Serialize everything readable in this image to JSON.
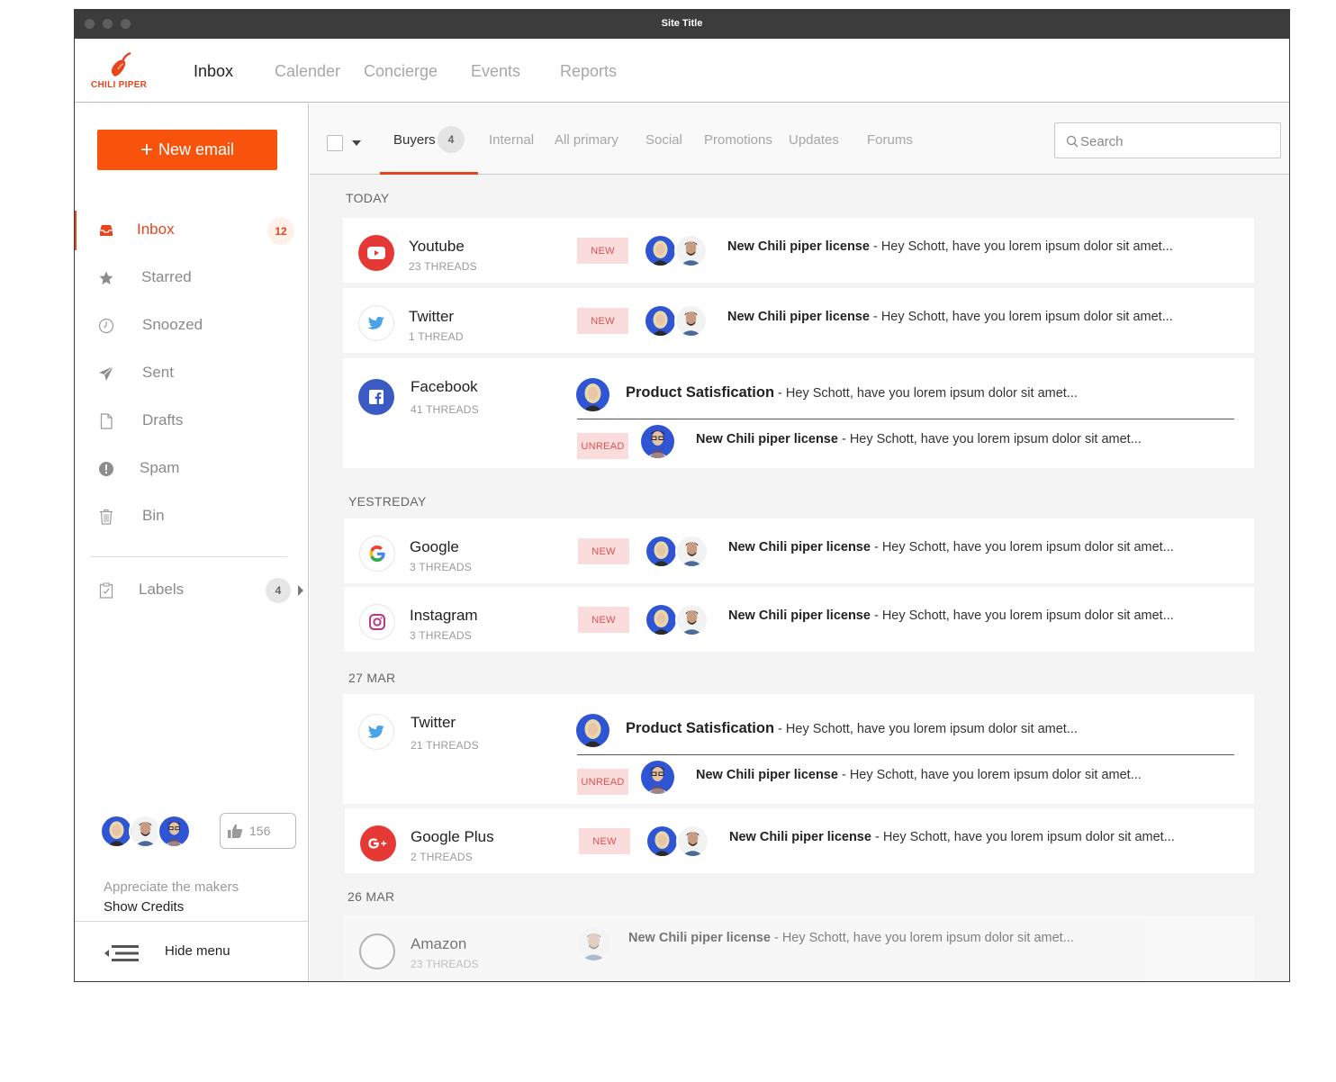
{
  "window": {
    "title": "Site Title"
  },
  "brand": {
    "name": "CHILI PIPER"
  },
  "topnav": {
    "items": [
      {
        "label": "Inbox",
        "active": true
      },
      {
        "label": "Calender",
        "active": false
      },
      {
        "label": "Concierge",
        "active": false
      },
      {
        "label": "Events",
        "active": false
      },
      {
        "label": "Reports",
        "active": false
      }
    ]
  },
  "sidebar": {
    "new_email_label": "New email",
    "items": [
      {
        "label": "Inbox",
        "icon": "inbox-icon",
        "count": "12",
        "active": true
      },
      {
        "label": "Starred",
        "icon": "star-icon"
      },
      {
        "label": "Snoozed",
        "icon": "clock-icon"
      },
      {
        "label": "Sent",
        "icon": "paper-plane-icon"
      },
      {
        "label": "Drafts",
        "icon": "document-icon"
      },
      {
        "label": "Spam",
        "icon": "alert-icon"
      },
      {
        "label": "Bin",
        "icon": "trash-icon"
      }
    ],
    "labels": {
      "label": "Labels",
      "count": "4"
    },
    "likes": "156",
    "appreciate": "Appreciate the makers",
    "show_credits": "Show Credits",
    "hide_menu": "Hide menu"
  },
  "tabs": {
    "items": [
      {
        "label": "Buyers",
        "count": "4",
        "active": true
      },
      {
        "label": "Internal"
      },
      {
        "label": "All primary"
      },
      {
        "label": "Social"
      },
      {
        "label": "Promotions"
      },
      {
        "label": "Updates"
      },
      {
        "label": "Forums"
      }
    ],
    "search_placeholder": "Search"
  },
  "sections": {
    "today": "TODAY",
    "yesterday": "YESTREDAY",
    "mar27": "27 MAR",
    "mar26": "26 MAR"
  },
  "threads": [
    {
      "source": "Youtube",
      "count": "23 THREADS",
      "tag": "NEW",
      "subject": "New Chili piper license",
      "preview": " - Hey Schott, have you lorem ipsum dolor sit amet..."
    },
    {
      "source": "Twitter",
      "count": "1 THREAD",
      "tag": "NEW",
      "subject": "New Chili piper license",
      "preview": " - Hey Schott, have you lorem ipsum dolor sit amet..."
    },
    {
      "source": "Facebook",
      "count": "41 THREADS",
      "primary": {
        "subject": "Product Satisfication",
        "preview": " - Hey Schott, have you lorem ipsum dolor sit amet..."
      },
      "secondary": {
        "tag": "UNREAD",
        "subject": "New Chili piper license",
        "preview": " - Hey Schott, have you lorem ipsum dolor sit amet..."
      }
    },
    {
      "source": "Google",
      "count": "3 THREADS",
      "tag": "NEW",
      "subject": "New Chili piper license",
      "preview": " - Hey Schott, have you lorem ipsum dolor sit amet..."
    },
    {
      "source": "Instagram",
      "count": "3 THREADS",
      "tag": "NEW",
      "subject": "New Chili piper license",
      "preview": " - Hey Schott, have you lorem ipsum dolor sit amet..."
    },
    {
      "source": "Twitter",
      "count": "21 THREADS",
      "primary": {
        "subject": "Product Satisfication",
        "preview": " - Hey Schott, have you lorem ipsum dolor sit amet..."
      },
      "secondary": {
        "tag": "UNREAD",
        "subject": "New Chili piper license",
        "preview": " - Hey Schott, have you lorem ipsum dolor sit amet..."
      }
    },
    {
      "source": "Google Plus",
      "count": "2 THREADS",
      "tag": "NEW",
      "subject": "New Chili piper license",
      "preview": " - Hey Schott, have you lorem ipsum dolor sit amet..."
    },
    {
      "source": "Amazon",
      "count": "23 THREADS",
      "subject": "New Chili piper license",
      "preview": " - Hey Schott, have you lorem ipsum dolor sit amet..."
    }
  ],
  "colors": {
    "accent": "#f8530d",
    "brand_red": "#e8451d",
    "avatar_blue": "#2f55d4"
  }
}
